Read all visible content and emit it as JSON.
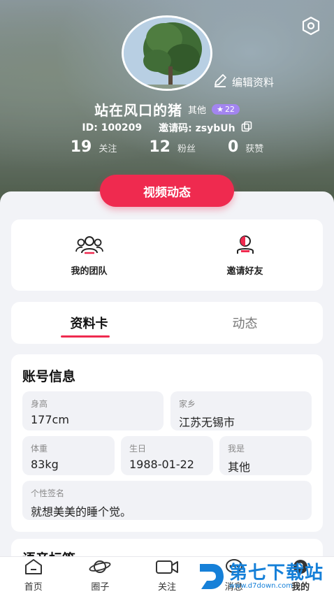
{
  "profile": {
    "nickname": "站在风口的猪",
    "gender_label": "其他",
    "level": "22",
    "edit_label": "编辑资料",
    "id_text": "ID: 100209",
    "invite_label": "邀请码: zsybUh"
  },
  "stats": [
    {
      "num": "19",
      "label": "关注"
    },
    {
      "num": "12",
      "label": "粉丝"
    },
    {
      "num": "0",
      "label": "获赞"
    }
  ],
  "video_button": "视频动态",
  "quick": {
    "team_label": "我的团队",
    "invite_label": "邀请好友"
  },
  "tabs": {
    "profile_card": "资料卡",
    "moments": "动态"
  },
  "account": {
    "title": "账号信息",
    "height_label": "身高",
    "height_value": "177cm",
    "hometown_label": "家乡",
    "hometown_value": "江苏无锡市",
    "weight_label": "体重",
    "weight_value": "83kg",
    "birthday_label": "生日",
    "birthday_value": "1988-01-22",
    "iam_label": "我是",
    "iam_value": "其他",
    "signature_label": "个性签名",
    "signature_value": "就想美美的睡个觉。"
  },
  "voice": {
    "title": "语音标签"
  },
  "tabbar": {
    "home": "首页",
    "circle": "圈子",
    "follow": "关注",
    "messages": "消息",
    "mine": "我的"
  },
  "watermark": {
    "brand": "第七下载站",
    "url": "www.d7down.com"
  },
  "colors": {
    "accent": "#ef2a4f",
    "badge": "#a385f0",
    "watermark": "#1680d8"
  },
  "icons": [
    "settings-icon",
    "edit-icon",
    "star-icon",
    "copy-icon",
    "team-icon",
    "invite-friend-icon",
    "home-icon",
    "planet-icon",
    "video-camera-icon",
    "message-icon",
    "user-icon"
  ]
}
